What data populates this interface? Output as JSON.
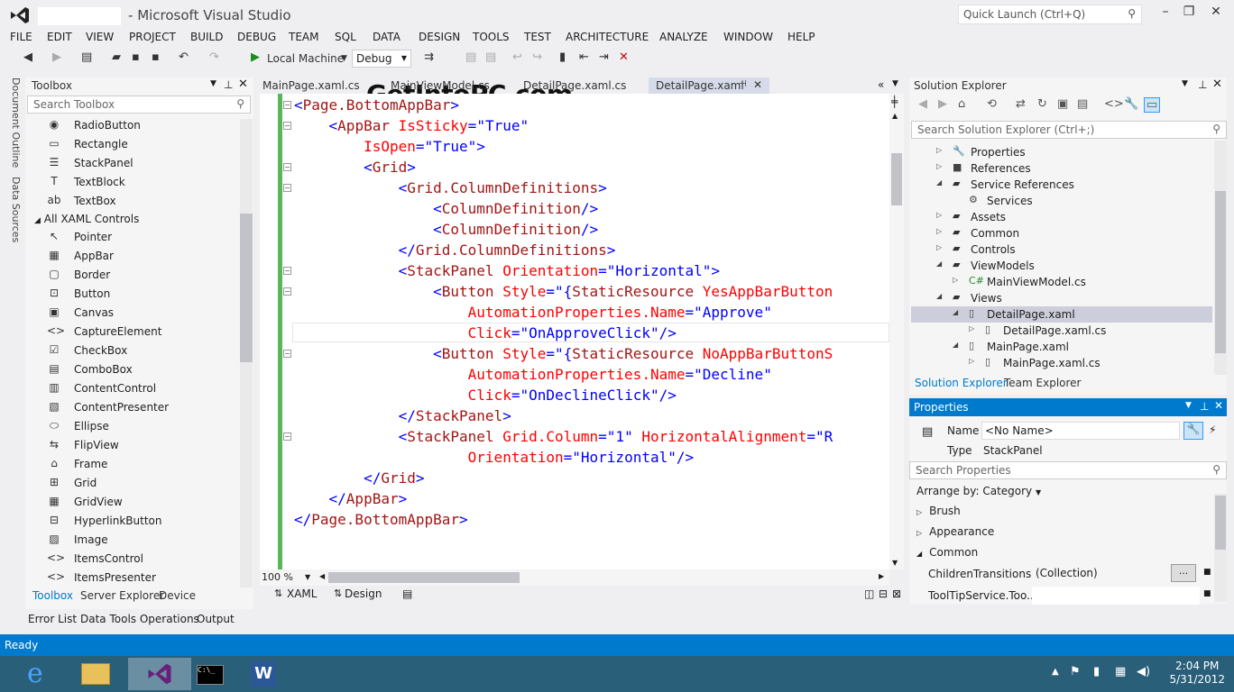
{
  "app": {
    "title": "Microsoft Visual Studio",
    "quick_launch_placeholder": "Quick Launch (Ctrl+Q)",
    "watermark": "GetIntoPC.com"
  },
  "menu": [
    "FILE",
    "EDIT",
    "VIEW",
    "PROJECT",
    "BUILD",
    "DEBUG",
    "TEAM",
    "SQL",
    "DATA",
    "DESIGN",
    "TOOLS",
    "TEST",
    "ARCHITECTURE",
    "ANALYZE",
    "WINDOW",
    "HELP"
  ],
  "toolbar": {
    "run_target": "Local Machine",
    "config": "Debug"
  },
  "side_tabs": [
    "Document Outline",
    "Data Sources"
  ],
  "toolbox": {
    "title": "Toolbox",
    "search_placeholder": "Search Toolbox",
    "items_top": [
      {
        "icon": "radio-icon",
        "glyph": "◉",
        "label": "RadioButton"
      },
      {
        "icon": "rectangle-icon",
        "glyph": "▭",
        "label": "Rectangle"
      },
      {
        "icon": "stackpanel-icon",
        "glyph": "☰",
        "label": "StackPanel"
      },
      {
        "icon": "textblock-icon",
        "glyph": "T",
        "label": "TextBlock"
      },
      {
        "icon": "textbox-icon",
        "glyph": "ab",
        "label": "TextBox"
      }
    ],
    "group_label": "All XAML Controls",
    "items": [
      {
        "icon": "pointer-icon",
        "glyph": "↖",
        "label": "Pointer"
      },
      {
        "icon": "appbar-icon",
        "glyph": "▦",
        "label": "AppBar"
      },
      {
        "icon": "border-icon",
        "glyph": "▢",
        "label": "Border"
      },
      {
        "icon": "button-icon",
        "glyph": "⊡",
        "label": "Button"
      },
      {
        "icon": "canvas-icon",
        "glyph": "▣",
        "label": "Canvas"
      },
      {
        "icon": "capture-icon",
        "glyph": "<>",
        "label": "CaptureElement"
      },
      {
        "icon": "checkbox-icon",
        "glyph": "☑",
        "label": "CheckBox"
      },
      {
        "icon": "combobox-icon",
        "glyph": "▤",
        "label": "ComboBox"
      },
      {
        "icon": "contentcontrol-icon",
        "glyph": "▥",
        "label": "ContentControl"
      },
      {
        "icon": "contentpresenter-icon",
        "glyph": "▧",
        "label": "ContentPresenter"
      },
      {
        "icon": "ellipse-icon",
        "glyph": "⬭",
        "label": "Ellipse"
      },
      {
        "icon": "flipview-icon",
        "glyph": "⇆",
        "label": "FlipView"
      },
      {
        "icon": "frame-icon",
        "glyph": "⌂",
        "label": "Frame"
      },
      {
        "icon": "grid-icon",
        "glyph": "⊞",
        "label": "Grid"
      },
      {
        "icon": "gridview-icon",
        "glyph": "▦",
        "label": "GridView"
      },
      {
        "icon": "hyperlink-icon",
        "glyph": "⊟",
        "label": "HyperlinkButton"
      },
      {
        "icon": "image-icon",
        "glyph": "▨",
        "label": "Image"
      },
      {
        "icon": "itemscontrol-icon",
        "glyph": "<>",
        "label": "ItemsControl"
      },
      {
        "icon": "itemspresenter-icon",
        "glyph": "<>",
        "label": "ItemsPresenter"
      }
    ],
    "bottom_tabs": [
      "Toolbox",
      "Server Explorer",
      "Device"
    ]
  },
  "doc_tabs": [
    "MainPage.xaml.cs",
    "MainViewModel.cs",
    "DetailPage.xaml.cs",
    "DetailPage.xaml"
  ],
  "editor": {
    "zoom": "100 %",
    "view_tabs": [
      "XAML",
      "Design"
    ],
    "lines": [
      [
        {
          "t": "<",
          "c": "br"
        },
        {
          "t": "Page.BottomAppBar",
          "c": "tag"
        },
        {
          "t": ">",
          "c": "br"
        }
      ],
      [
        {
          "t": "    <",
          "c": "br"
        },
        {
          "t": "AppBar",
          "c": "tag"
        },
        {
          "t": " IsSticky",
          "c": "attr"
        },
        {
          "t": "=",
          "c": "br"
        },
        {
          "t": "\"True\"",
          "c": "val"
        }
      ],
      [
        {
          "t": "        IsOpen",
          "c": "attr"
        },
        {
          "t": "=",
          "c": "br"
        },
        {
          "t": "\"True\"",
          "c": "val"
        },
        {
          "t": ">",
          "c": "br"
        }
      ],
      [
        {
          "t": "        <",
          "c": "br"
        },
        {
          "t": "Grid",
          "c": "tag"
        },
        {
          "t": ">",
          "c": "br"
        }
      ],
      [
        {
          "t": "            <",
          "c": "br"
        },
        {
          "t": "Grid.ColumnDefinitions",
          "c": "tag"
        },
        {
          "t": ">",
          "c": "br"
        }
      ],
      [
        {
          "t": "                <",
          "c": "br"
        },
        {
          "t": "ColumnDefinition",
          "c": "tag"
        },
        {
          "t": "/>",
          "c": "br"
        }
      ],
      [
        {
          "t": "                <",
          "c": "br"
        },
        {
          "t": "ColumnDefinition",
          "c": "tag"
        },
        {
          "t": "/>",
          "c": "br"
        }
      ],
      [
        {
          "t": "            </",
          "c": "br"
        },
        {
          "t": "Grid.ColumnDefinitions",
          "c": "tag"
        },
        {
          "t": ">",
          "c": "br"
        }
      ],
      [
        {
          "t": "            <",
          "c": "br"
        },
        {
          "t": "StackPanel",
          "c": "tag"
        },
        {
          "t": " Orientation",
          "c": "attr"
        },
        {
          "t": "=",
          "c": "br"
        },
        {
          "t": "\"Horizontal\"",
          "c": "val"
        },
        {
          "t": ">",
          "c": "br"
        }
      ],
      [
        {
          "t": "                <",
          "c": "br"
        },
        {
          "t": "Button",
          "c": "tag"
        },
        {
          "t": " Style",
          "c": "attr"
        },
        {
          "t": "=",
          "c": "br"
        },
        {
          "t": "\"{",
          "c": "val"
        },
        {
          "t": "StaticResource",
          "c": "tag"
        },
        {
          "t": " YesAppBarButton",
          "c": "attr"
        }
      ],
      [
        {
          "t": "                    AutomationProperties.Name",
          "c": "attr"
        },
        {
          "t": "=",
          "c": "br"
        },
        {
          "t": "\"Approve\"",
          "c": "val"
        }
      ],
      [
        {
          "t": "                    Click",
          "c": "attr"
        },
        {
          "t": "=",
          "c": "br"
        },
        {
          "t": "\"OnApproveClick\"",
          "c": "val"
        },
        {
          "t": "/>",
          "c": "br"
        }
      ],
      [
        {
          "t": "                <",
          "c": "br"
        },
        {
          "t": "Button",
          "c": "tag"
        },
        {
          "t": " Style",
          "c": "attr"
        },
        {
          "t": "=",
          "c": "br"
        },
        {
          "t": "\"{",
          "c": "val"
        },
        {
          "t": "StaticResource",
          "c": "tag"
        },
        {
          "t": " NoAppBarButtonS",
          "c": "attr"
        }
      ],
      [
        {
          "t": "                    AutomationProperties.Name",
          "c": "attr"
        },
        {
          "t": "=",
          "c": "br"
        },
        {
          "t": "\"Decline\"",
          "c": "val"
        }
      ],
      [
        {
          "t": "                    Click",
          "c": "attr"
        },
        {
          "t": "=",
          "c": "br"
        },
        {
          "t": "\"OnDeclineClick\"",
          "c": "val"
        },
        {
          "t": "/>",
          "c": "br"
        }
      ],
      [
        {
          "t": "            </",
          "c": "br"
        },
        {
          "t": "StackPanel",
          "c": "tag"
        },
        {
          "t": ">",
          "c": "br"
        }
      ],
      [
        {
          "t": "            <",
          "c": "br"
        },
        {
          "t": "StackPanel",
          "c": "tag"
        },
        {
          "t": " Grid.Column",
          "c": "attr"
        },
        {
          "t": "=",
          "c": "br"
        },
        {
          "t": "\"1\"",
          "c": "val"
        },
        {
          "t": " HorizontalAlignment",
          "c": "attr"
        },
        {
          "t": "=",
          "c": "br"
        },
        {
          "t": "\"R",
          "c": "val"
        }
      ],
      [
        {
          "t": "                    Orientation",
          "c": "attr"
        },
        {
          "t": "=",
          "c": "br"
        },
        {
          "t": "\"Horizontal\"",
          "c": "val"
        },
        {
          "t": "/>",
          "c": "br"
        }
      ],
      [
        {
          "t": "        </",
          "c": "br"
        },
        {
          "t": "Grid",
          "c": "tag"
        },
        {
          "t": ">",
          "c": "br"
        }
      ],
      [
        {
          "t": "    </",
          "c": "br"
        },
        {
          "t": "AppBar",
          "c": "tag"
        },
        {
          "t": ">",
          "c": "br"
        }
      ],
      [
        {
          "t": "</",
          "c": "br"
        },
        {
          "t": "Page.BottomAppBar",
          "c": "tag"
        },
        {
          "t": ">",
          "c": "br"
        }
      ]
    ]
  },
  "solution_explorer": {
    "title": "Solution Explorer",
    "search_placeholder": "Search Solution Explorer (Ctrl+;)",
    "tree": [
      {
        "indent": 0,
        "arrow": "▷",
        "icon": "wrench-icon",
        "glyph": "🔧",
        "label": "Properties"
      },
      {
        "indent": 0,
        "arrow": "▷",
        "icon": "references-icon",
        "glyph": "■",
        "label": "References"
      },
      {
        "indent": 0,
        "arrow": "◢",
        "icon": "folder-icon",
        "glyph": "▰",
        "label": "Service References"
      },
      {
        "indent": 1,
        "arrow": "",
        "icon": "services-icon",
        "glyph": "⚙",
        "label": "Services"
      },
      {
        "indent": 0,
        "arrow": "▷",
        "icon": "folder-icon",
        "glyph": "▰",
        "label": "Assets"
      },
      {
        "indent": 0,
        "arrow": "▷",
        "icon": "folder-icon",
        "glyph": "▰",
        "label": "Common"
      },
      {
        "indent": 0,
        "arrow": "▷",
        "icon": "folder-icon",
        "glyph": "▰",
        "label": "Controls"
      },
      {
        "indent": 0,
        "arrow": "◢",
        "icon": "folder-icon",
        "glyph": "▰",
        "label": "ViewModels"
      },
      {
        "indent": 1,
        "arrow": "▷",
        "icon": "csharp-icon",
        "glyph": "C#",
        "label": "MainViewModel.cs"
      },
      {
        "indent": 0,
        "arrow": "◢",
        "icon": "folder-icon",
        "glyph": "▰",
        "label": "Views"
      },
      {
        "indent": 1,
        "arrow": "◢",
        "icon": "xaml-icon",
        "glyph": "▯",
        "label": "DetailPage.xaml",
        "selected": true
      },
      {
        "indent": 2,
        "arrow": "▷",
        "icon": "xaml-icon",
        "glyph": "▯",
        "label": "DetailPage.xaml.cs"
      },
      {
        "indent": 1,
        "arrow": "◢",
        "icon": "xaml-icon",
        "glyph": "▯",
        "label": "MainPage.xaml"
      },
      {
        "indent": 2,
        "arrow": "▷",
        "icon": "xaml-icon",
        "glyph": "▯",
        "label": "MainPage.xaml.cs"
      }
    ],
    "bottom_tabs": [
      "Solution Explorer",
      "Team Explorer"
    ]
  },
  "properties": {
    "title": "Properties",
    "name_label": "Name",
    "name_value": "<No Name>",
    "type_label": "Type",
    "type_value": "StackPanel",
    "search_placeholder": "Search Properties",
    "arrange": "Arrange by: Category",
    "categories": [
      {
        "arrow": "▷",
        "label": "Brush"
      },
      {
        "arrow": "▷",
        "label": "Appearance"
      },
      {
        "arrow": "◢",
        "label": "Common"
      }
    ],
    "rows": [
      {
        "label": "ChildrenTransitions",
        "value": "(Collection)",
        "button": "..."
      },
      {
        "label": "ToolTipService.Too...",
        "value": ""
      }
    ]
  },
  "bottom_tabs": [
    "Error List",
    "Data Tools Operations",
    "Output"
  ],
  "status": "Ready",
  "clock": {
    "time": "2:04 PM",
    "date": "5/31/2012"
  },
  "colors": {
    "accent": "#007acc",
    "gutter": "#5bb65b",
    "taskbar": "#2a5f7a"
  }
}
